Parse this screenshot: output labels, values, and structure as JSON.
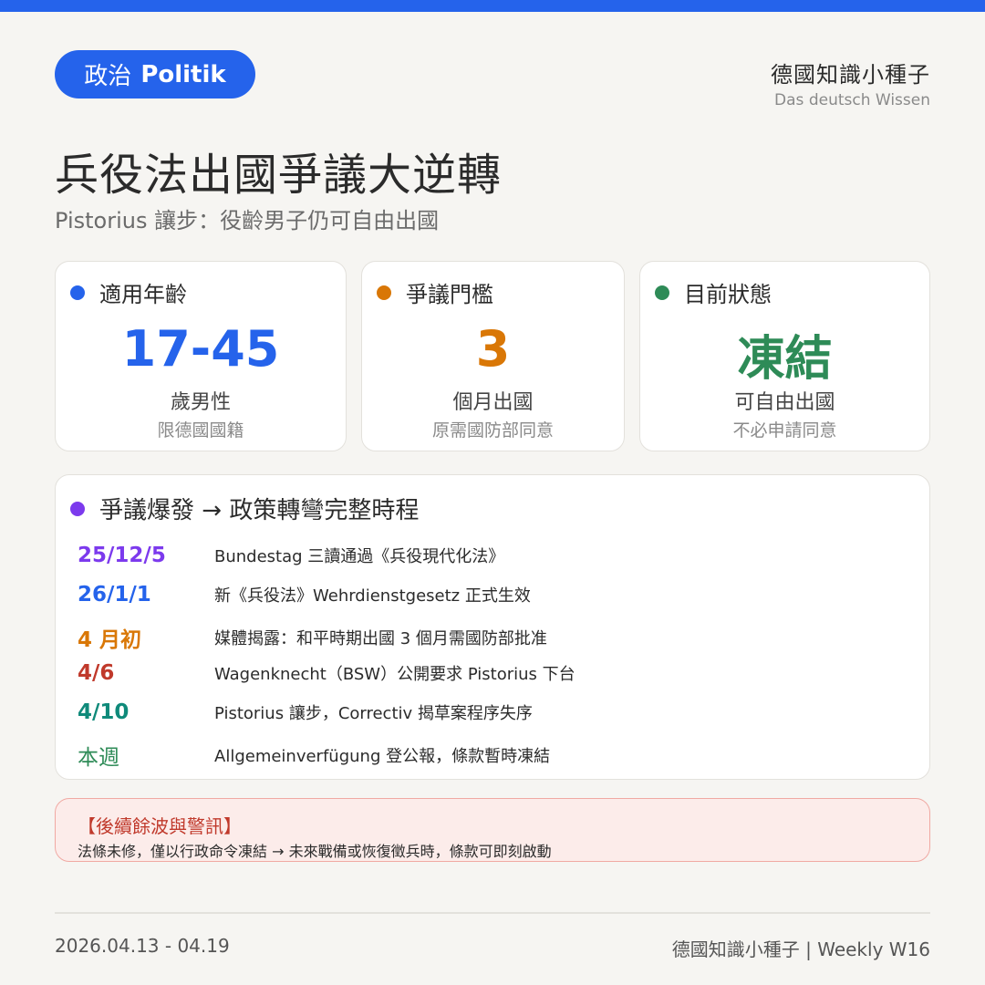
{
  "header": {
    "pill_zh": "政治",
    "pill_en": "Politik",
    "brand_zh": "德國知識小種子",
    "brand_de": "Das deutsch Wissen"
  },
  "title": "兵役法出國爭議大逆轉",
  "subtitle": "Pistorius 讓步：役齡男子仍可自由出國",
  "cards": [
    {
      "head": "適用年齡",
      "value": "17-45",
      "line1": "歲男性",
      "line2": "限德國國籍",
      "color": "#2563eb"
    },
    {
      "head": "爭議門檻",
      "value": "3",
      "line1": "個月出國",
      "line2": "原需國防部同意",
      "color": "#d97706"
    },
    {
      "head": "目前狀態",
      "value": "凍結",
      "line1": "可自由出國",
      "line2": "不必申請同意",
      "color": "#2e8b57"
    }
  ],
  "timeline": {
    "head": "爭議爆發 → 政策轉彎完整時程",
    "color": "#7c3aed",
    "rows": [
      {
        "date": "25/12/5",
        "event": "Bundestag 三讀通過《兵役現代化法》",
        "color": "#7c3aed"
      },
      {
        "date": "26/1/1",
        "event": "新《兵役法》Wehrdienstgesetz 正式生效",
        "color": "#2563eb"
      },
      {
        "date": "4 月初",
        "event": "媒體揭露：和平時期出國 3 個月需國防部批准",
        "color": "#d97706"
      },
      {
        "date": "4/6",
        "event": "Wagenknecht（BSW）公開要求 Pistorius 下台",
        "color": "#c0392b"
      },
      {
        "date": "4/10",
        "event": "Pistorius 讓步，Correctiv 揭草案程序失序",
        "color": "#0f8a7a"
      },
      {
        "date": "本週",
        "event": "Allgemeinverfügung 登公報，條款暫時凍結",
        "color": "#2e8b57"
      }
    ]
  },
  "warning": {
    "title": "【後續餘波與警訊】",
    "body": "法條未修，僅以行政命令凍結 → 未來戰備或恢復徵兵時，條款可即刻啟動"
  },
  "footer": {
    "date_range": "2026.04.13 - 04.19",
    "right": "德國知識小種子 | Weekly W16"
  }
}
